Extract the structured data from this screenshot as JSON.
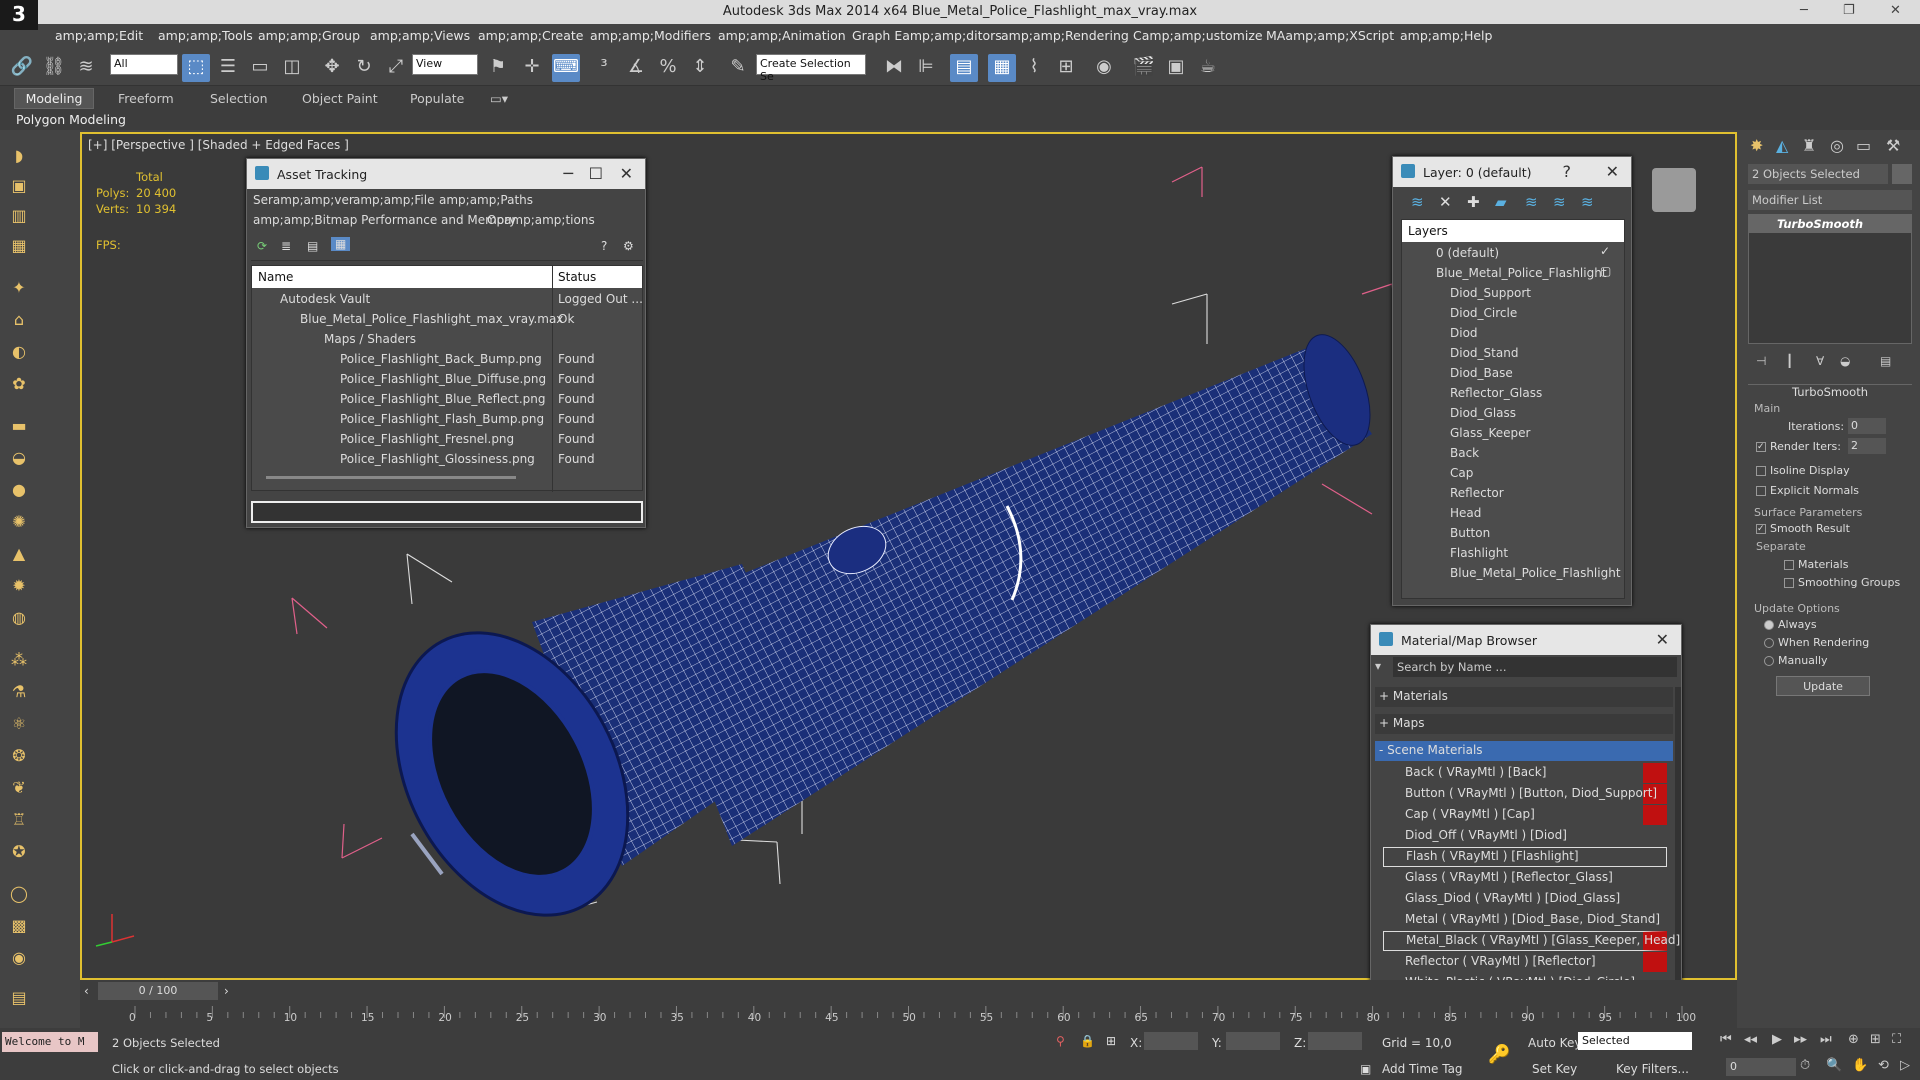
{
  "window": {
    "title": "Autodesk 3ds Max  2014 x64      Blue_Metal_Police_Flashlight_max_vray.max"
  },
  "menu": [
    "amp;amp;Edit",
    "amp;amp;Tools",
    "amp;amp;Group",
    "amp;amp;Views",
    "amp;amp;Create",
    "amp;amp;Modifiers",
    "amp;amp;Animation",
    "Graph Eamp;amp;ditors",
    "amp;amp;Rendering",
    "Camp;amp;ustomize",
    "MAamp;amp;XScript",
    "amp;amp;Help"
  ],
  "toolbar": {
    "filter": "All",
    "refcoord": "View",
    "selset": "Create Selection Se"
  },
  "ribbon": {
    "tabs": [
      "Modeling",
      "Freeform",
      "Selection",
      "Object Paint",
      "Populate"
    ],
    "sub": "Polygon Modeling"
  },
  "viewport": {
    "label": "[+] [Perspective ] [Shaded + Edged Faces ]",
    "total": "Total",
    "polys_label": "Polys:",
    "polys": "20 400",
    "verts_label": "Verts:",
    "verts": "10 394",
    "fps": "FPS:"
  },
  "asset": {
    "title": "Asset Tracking",
    "menu1": [
      "Seramp;amp;ver",
      "amp;amp;File",
      "amp;amp;Paths"
    ],
    "menu2": [
      "amp;amp;Bitmap Performance and Memory",
      "Opamp;amp;tions"
    ],
    "col_name": "Name",
    "col_status": "Status",
    "rows": [
      {
        "name": "Autodesk Vault",
        "status": "Logged Out ..."
      },
      {
        "name": "Blue_Metal_Police_Flashlight_max_vray.max",
        "status": "Ok"
      },
      {
        "name": "Maps / Shaders",
        "status": ""
      },
      {
        "name": "Police_Flashlight_Back_Bump.png",
        "status": "Found"
      },
      {
        "name": "Police_Flashlight_Blue_Diffuse.png",
        "status": "Found"
      },
      {
        "name": "Police_Flashlight_Blue_Reflect.png",
        "status": "Found"
      },
      {
        "name": "Police_Flashlight_Flash_Bump.png",
        "status": "Found"
      },
      {
        "name": "Police_Flashlight_Fresnel.png",
        "status": "Found"
      },
      {
        "name": "Police_Flashlight_Glossiness.png",
        "status": "Found"
      }
    ]
  },
  "layer": {
    "title": "Layer: 0 (default)",
    "header": "Layers",
    "items": [
      "0 (default)",
      "Blue_Metal_Police_Flashlight",
      "Diod_Support",
      "Diod_Circle",
      "Diod",
      "Diod_Stand",
      "Diod_Base",
      "Reflector_Glass",
      "Diod_Glass",
      "Glass_Keeper",
      "Back",
      "Cap",
      "Reflector",
      "Head",
      "Button",
      "Flashlight",
      "Blue_Metal_Police_Flashlight"
    ]
  },
  "matbrowser": {
    "title": "Material/Map Browser",
    "search": "Search by Name ...",
    "sections": [
      "+ Materials",
      "+ Maps",
      "- Scene Materials"
    ],
    "mats": [
      "Back  ( VRayMtl )  [Back]",
      "Button  ( VRayMtl )  [Button, Diod_Support]",
      "Cap  ( VRayMtl )  [Cap]",
      "Diod_Off  ( VRayMtl )  [Diod]",
      "Flash  ( VRayMtl )  [Flashlight]",
      "Glass  ( VRayMtl )  [Reflector_Glass]",
      "Glass_Diod  ( VRayMtl )  [Diod_Glass]",
      "Metal  ( VRayMtl )  [Diod_Base, Diod_Stand]",
      "Metal_Black  ( VRayMtl )  [Glass_Keeper, Head]",
      "Reflector  ( VRayMtl )  [Reflector]",
      "White_Plastic  ( VRayMtl )  [Diod_Circle]"
    ]
  },
  "cmd": {
    "selected": "2 Objects Selected",
    "modlist": "Modifier List",
    "modifier": "TurboSmooth",
    "rollout": "TurboSmooth",
    "main": "Main",
    "iter_label": "Iterations:",
    "iter": "0",
    "render_label": "Render Iters:",
    "render": "2",
    "isoline": "Isoline Display",
    "explicit": "Explicit Normals",
    "surface": "Surface Parameters",
    "smooth": "Smooth Result",
    "separate": "Separate",
    "materials": "Materials",
    "smgroups": "Smoothing Groups",
    "update_opts": "Update Options",
    "always": "Always",
    "when": "When Rendering",
    "manually": "Manually",
    "update": "Update"
  },
  "timeline": {
    "frame": "0 / 100",
    "ticks": [
      "0",
      "5",
      "10",
      "15",
      "20",
      "25",
      "30",
      "35",
      "40",
      "45",
      "50",
      "55",
      "60",
      "65",
      "70",
      "75",
      "80",
      "85",
      "90",
      "95",
      "100"
    ]
  },
  "status": {
    "welcome": "Welcome to M",
    "selected": "2 Objects Selected",
    "prompt": "Click or click-and-drag to select objects",
    "x": "X:",
    "y": "Y:",
    "z": "Z:",
    "grid": "Grid = 10,0",
    "addtime": "Add Time Tag",
    "autokey": "Auto Key",
    "setkey": "Set Key",
    "keymode": "Selected",
    "keyfilters": "Key Filters...",
    "frame": "0"
  }
}
